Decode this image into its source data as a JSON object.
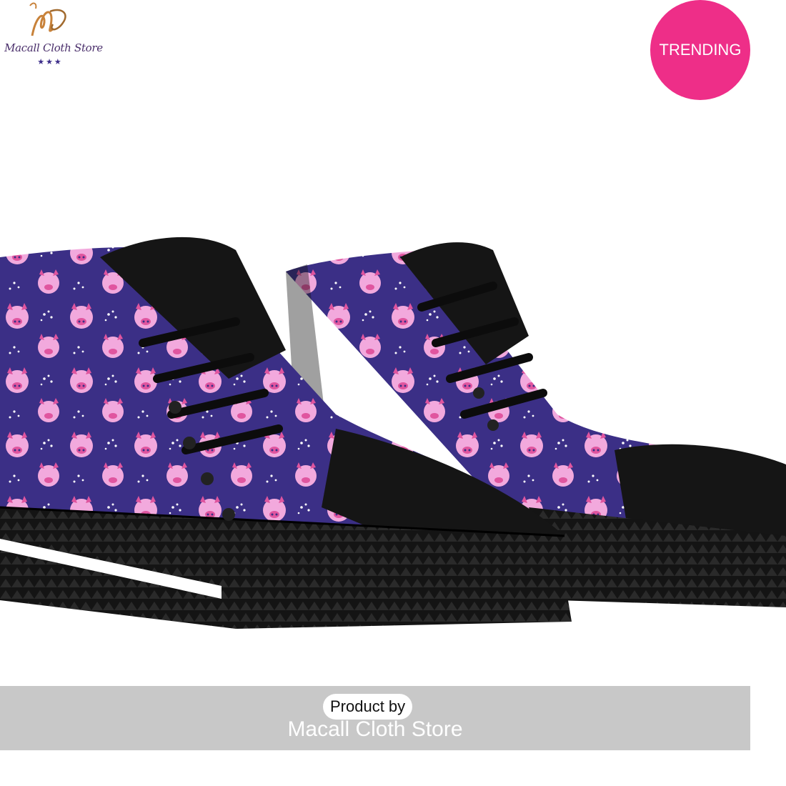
{
  "brand": {
    "logo_text": "Macall Cloth Store",
    "stars": "★★★"
  },
  "badge": {
    "label": "TRENDING"
  },
  "footer": {
    "product_by": "Product by",
    "store_name": "Macall Cloth Store"
  },
  "colors": {
    "badge": "#ee2e88",
    "canvas": "#3b2f86",
    "pig": "#f2a9dd",
    "rubber": "#111111"
  }
}
